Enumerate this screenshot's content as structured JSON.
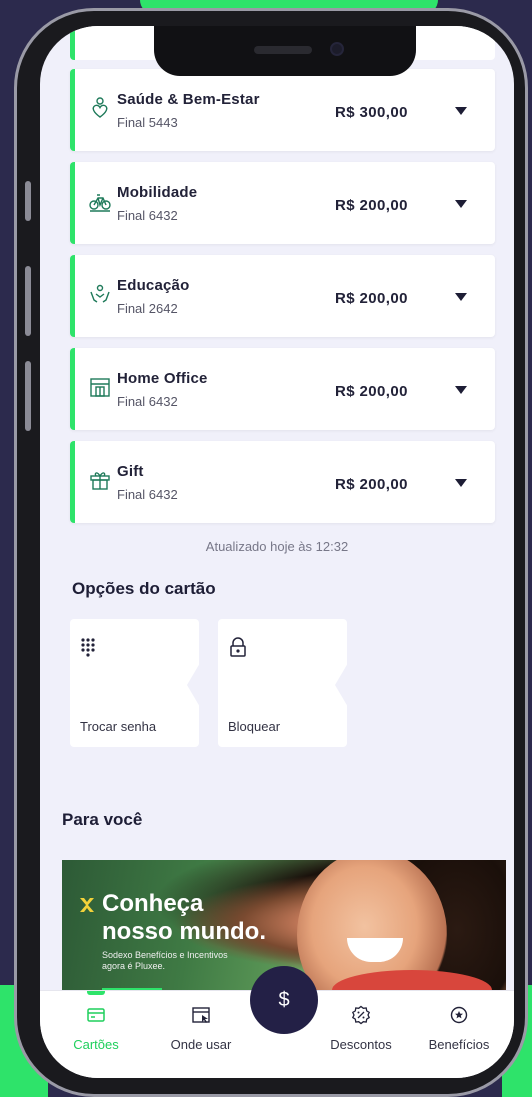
{
  "cards": [
    {
      "name": "Saúde & Bem-Estar",
      "final": "Final 5443",
      "amount": "R$ 300,00",
      "icon": "health-heart-icon"
    },
    {
      "name": "Mobilidade",
      "final": "Final 6432",
      "amount": "R$ 200,00",
      "icon": "bicycle-icon"
    },
    {
      "name": "Educação",
      "final": "Final 2642",
      "amount": "R$ 200,00",
      "icon": "education-hands-icon"
    },
    {
      "name": "Home Office",
      "final": "Final 6432",
      "amount": "R$ 200,00",
      "icon": "home-office-icon"
    },
    {
      "name": "Gift",
      "final": "Final 6432",
      "amount": "R$ 200,00",
      "icon": "gift-icon"
    }
  ],
  "updated": "Atualizado hoje às 12:32",
  "card_options": {
    "title": "Opções do cartão",
    "change_password": "Trocar senha",
    "block": "Bloquear"
  },
  "for_you": {
    "title": "Para você",
    "banner_line1": "Conheça",
    "banner_line2": "nosso mundo.",
    "banner_sub1": "Sodexo Benefícios e Incentivos",
    "banner_sub2": "agora é Pluxee."
  },
  "nav": {
    "cards": "Cartões",
    "where": "Onde usar",
    "fab": "$",
    "discounts": "Descontos",
    "benefits": "Benefícios"
  },
  "colors": {
    "accent": "#2ee36a",
    "navy": "#232046",
    "screen_bg": "#f0f0fa"
  }
}
